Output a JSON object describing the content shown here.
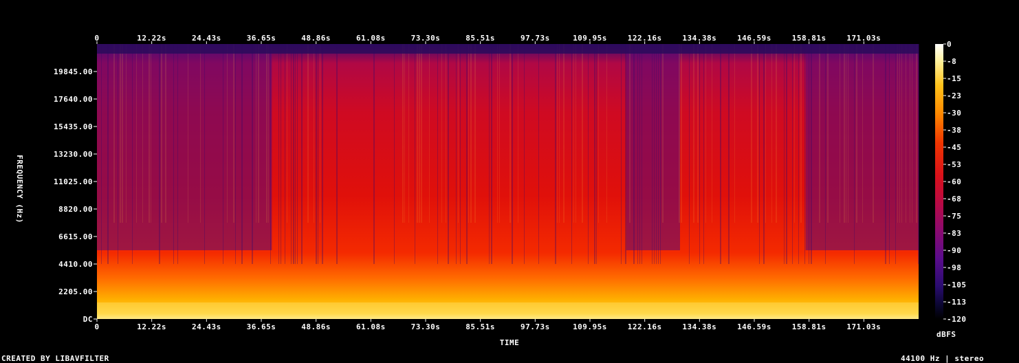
{
  "chart_data": {
    "type": "heatmap",
    "title": "",
    "xlabel": "TIME",
    "ylabel": "FREQUENCY (Hz)",
    "x_ticks": [
      "0",
      "12.22s",
      "24.43s",
      "36.65s",
      "48.86s",
      "61.08s",
      "73.30s",
      "85.51s",
      "97.73s",
      "109.95s",
      "122.16s",
      "134.38s",
      "146.59s",
      "158.81s",
      "171.03s"
    ],
    "y_ticks": [
      "DC",
      "2205.00",
      "4410.00",
      "6615.00",
      "8820.00",
      "11025.00",
      "13230.00",
      "15435.00",
      "17640.00",
      "19845.00"
    ],
    "colorbar": {
      "label": "dBFS",
      "ticks": [
        "0",
        "-8",
        "-15",
        "-23",
        "-30",
        "-38",
        "-45",
        "-53",
        "-60",
        "-68",
        "-75",
        "-83",
        "-90",
        "-98",
        "-105",
        "-113",
        "-120"
      ],
      "range": [
        -120,
        0
      ]
    },
    "xlim_seconds": [
      0,
      183.2
    ],
    "ylim_hz": [
      0,
      22050
    ],
    "loud_sections": [
      {
        "start_s": 0,
        "end_s": 16.5,
        "level": "mid"
      },
      {
        "start_s": 16.5,
        "end_s": 39.0,
        "level": "mid"
      },
      {
        "start_s": 39.0,
        "end_s": 69.0,
        "level": "high"
      },
      {
        "start_s": 69.0,
        "end_s": 95.0,
        "level": "high"
      },
      {
        "start_s": 95.0,
        "end_s": 118.0,
        "level": "high"
      },
      {
        "start_s": 118.0,
        "end_s": 130.0,
        "level": "mid"
      },
      {
        "start_s": 130.0,
        "end_s": 152.0,
        "level": "high"
      },
      {
        "start_s": 152.0,
        "end_s": 158.0,
        "level": "high"
      },
      {
        "start_s": 158.0,
        "end_s": 183.2,
        "level": "mid"
      }
    ],
    "grid": false
  },
  "footer": {
    "credit": "CREATED BY LIBAVFILTER",
    "format": "44100 Hz | stereo"
  },
  "colors": {
    "background": "#000000",
    "text": "#ffffff"
  }
}
